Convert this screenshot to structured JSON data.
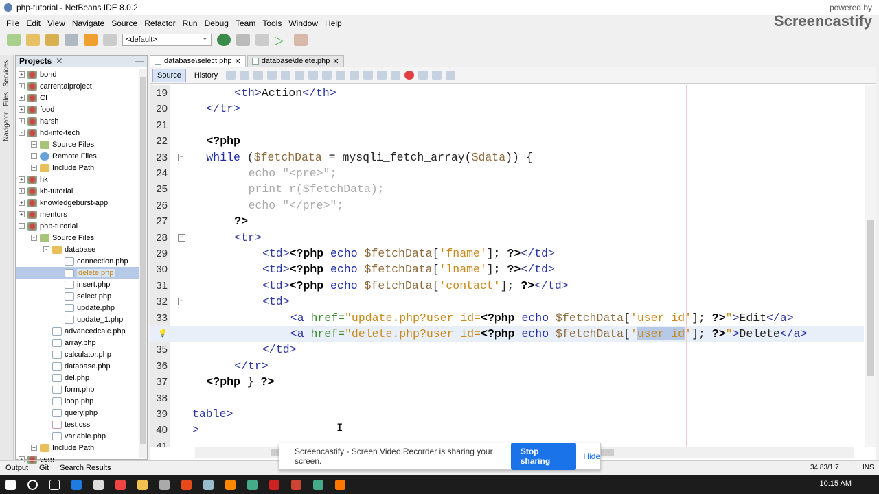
{
  "window": {
    "title": "php-tutorial - NetBeans IDE 8.0.2"
  },
  "menu": [
    "File",
    "Edit",
    "View",
    "Navigate",
    "Source",
    "Refactor",
    "Run",
    "Debug",
    "Team",
    "Tools",
    "Window",
    "Help"
  ],
  "toolbar": {
    "config": "<default>"
  },
  "side_tabs": [
    "Services",
    "Files",
    "Navigator"
  ],
  "projects": {
    "title": "Projects",
    "tree": [
      {
        "label": "bond",
        "d": 0,
        "t": "project",
        "e": "+"
      },
      {
        "label": "carrentalproject",
        "d": 0,
        "t": "project",
        "e": "+"
      },
      {
        "label": "CI",
        "d": 0,
        "t": "project",
        "e": "+"
      },
      {
        "label": "food",
        "d": 0,
        "t": "project",
        "e": "+"
      },
      {
        "label": "harsh",
        "d": 0,
        "t": "project",
        "e": "+"
      },
      {
        "label": "hd-info-tech",
        "d": 0,
        "t": "project",
        "e": "-"
      },
      {
        "label": "Source Files",
        "d": 1,
        "t": "srcfolder",
        "e": "+"
      },
      {
        "label": "Remote Files",
        "d": 1,
        "t": "remote",
        "e": "+"
      },
      {
        "label": "Include Path",
        "d": 1,
        "t": "folder",
        "e": "+"
      },
      {
        "label": "hk",
        "d": 0,
        "t": "project",
        "e": "+"
      },
      {
        "label": "kb-tutorial",
        "d": 0,
        "t": "project",
        "e": "+"
      },
      {
        "label": "knowledgeburst-app",
        "d": 0,
        "t": "project",
        "e": "+"
      },
      {
        "label": "mentors",
        "d": 0,
        "t": "project",
        "e": "+"
      },
      {
        "label": "php-tutorial",
        "d": 0,
        "t": "project",
        "e": "-"
      },
      {
        "label": "Source Files",
        "d": 1,
        "t": "srcfolder",
        "e": "-"
      },
      {
        "label": "database",
        "d": 2,
        "t": "folder",
        "e": "-"
      },
      {
        "label": "connection.php",
        "d": 3,
        "t": "file"
      },
      {
        "label": "delete.php",
        "d": 3,
        "t": "file",
        "sel": true
      },
      {
        "label": "insert.php",
        "d": 3,
        "t": "file"
      },
      {
        "label": "select.php",
        "d": 3,
        "t": "file"
      },
      {
        "label": "update.php",
        "d": 3,
        "t": "file"
      },
      {
        "label": "update_1.php",
        "d": 3,
        "t": "file"
      },
      {
        "label": "advancedcalc.php",
        "d": 2,
        "t": "file"
      },
      {
        "label": "array.php",
        "d": 2,
        "t": "file"
      },
      {
        "label": "calculator.php",
        "d": 2,
        "t": "file"
      },
      {
        "label": "database.php",
        "d": 2,
        "t": "file"
      },
      {
        "label": "del.php",
        "d": 2,
        "t": "file"
      },
      {
        "label": "form.php",
        "d": 2,
        "t": "file"
      },
      {
        "label": "loop.php",
        "d": 2,
        "t": "file"
      },
      {
        "label": "query.php",
        "d": 2,
        "t": "file"
      },
      {
        "label": "test.css",
        "d": 2,
        "t": "css"
      },
      {
        "label": "variable.php",
        "d": 2,
        "t": "file"
      },
      {
        "label": "Include Path",
        "d": 1,
        "t": "folder",
        "e": "+"
      },
      {
        "label": "vem",
        "d": 0,
        "t": "project",
        "e": "+"
      }
    ]
  },
  "editor": {
    "tabs": [
      {
        "label": "database\\select.php",
        "active": true
      },
      {
        "label": "database\\delete.php",
        "active": false
      }
    ],
    "modes": [
      "Source",
      "History"
    ],
    "lines": [
      {
        "n": "19",
        "i": 6,
        "tok": [
          [
            "tag",
            "<th>"
          ],
          [
            "pl",
            "Action"
          ],
          [
            "tag",
            "</th>"
          ]
        ]
      },
      {
        "n": "20",
        "i": 2,
        "tok": [
          [
            "tag",
            "</tr>"
          ]
        ]
      },
      {
        "n": "21",
        "i": 0,
        "tok": []
      },
      {
        "n": "22",
        "i": 2,
        "tok": [
          [
            "kw",
            "<?php"
          ]
        ]
      },
      {
        "n": "23",
        "i": 2,
        "f": "-",
        "tok": [
          [
            "echo",
            "while "
          ],
          [
            "pl",
            "("
          ],
          [
            "var",
            "$fetchData"
          ],
          [
            "pl",
            " = mysqli_fetch_array("
          ],
          [
            "var",
            "$data"
          ],
          [
            "pl",
            ")) {"
          ]
        ]
      },
      {
        "n": "24",
        "i": 8,
        "tok": [
          [
            "cm",
            "echo \"<pre>\";"
          ]
        ]
      },
      {
        "n": "25",
        "i": 8,
        "tok": [
          [
            "cm",
            "print_r($fetchData);"
          ]
        ]
      },
      {
        "n": "26",
        "i": 8,
        "tok": [
          [
            "cm",
            "echo \"</pre>\";"
          ]
        ]
      },
      {
        "n": "27",
        "i": 6,
        "tok": [
          [
            "kw",
            "?>"
          ]
        ]
      },
      {
        "n": "28",
        "i": 6,
        "f": "-",
        "tok": [
          [
            "tag",
            "<tr>"
          ]
        ]
      },
      {
        "n": "29",
        "i": 10,
        "tok": [
          [
            "tag",
            "<td>"
          ],
          [
            "kw",
            "<?php"
          ],
          [
            "echo",
            " echo "
          ],
          [
            "var",
            "$fetchData"
          ],
          [
            "pl",
            "["
          ],
          [
            "str",
            "'fname'"
          ],
          [
            "pl",
            "]; "
          ],
          [
            "kw",
            "?>"
          ],
          [
            "tag",
            "</td>"
          ]
        ]
      },
      {
        "n": "30",
        "i": 10,
        "tok": [
          [
            "tag",
            "<td>"
          ],
          [
            "kw",
            "<?php"
          ],
          [
            "echo",
            " echo "
          ],
          [
            "var",
            "$fetchData"
          ],
          [
            "pl",
            "["
          ],
          [
            "str",
            "'lname'"
          ],
          [
            "pl",
            "]; "
          ],
          [
            "kw",
            "?>"
          ],
          [
            "tag",
            "</td>"
          ]
        ]
      },
      {
        "n": "31",
        "i": 10,
        "tok": [
          [
            "tag",
            "<td>"
          ],
          [
            "kw",
            "<?php"
          ],
          [
            "echo",
            " echo "
          ],
          [
            "var",
            "$fetchData"
          ],
          [
            "pl",
            "["
          ],
          [
            "str",
            "'contact'"
          ],
          [
            "pl",
            "]; "
          ],
          [
            "kw",
            "?>"
          ],
          [
            "tag",
            "</td>"
          ]
        ]
      },
      {
        "n": "32",
        "i": 10,
        "f": "-",
        "tok": [
          [
            "tag",
            "<td>"
          ]
        ]
      },
      {
        "n": "33",
        "i": 14,
        "tok": [
          [
            "tag",
            "<a "
          ],
          [
            "attr",
            "href="
          ],
          [
            "str",
            "\"update.php?user_id="
          ],
          [
            "kw",
            "<?php"
          ],
          [
            "echo",
            " echo "
          ],
          [
            "var",
            "$fetchData"
          ],
          [
            "pl",
            "["
          ],
          [
            "str",
            "'user_id'"
          ],
          [
            "pl",
            "]; "
          ],
          [
            "kw",
            "?>"
          ],
          [
            "str",
            "\""
          ],
          [
            "tag",
            ">"
          ],
          [
            "pl",
            "Edit"
          ],
          [
            "tag",
            "</a>"
          ]
        ]
      },
      {
        "n": "34",
        "i": 14,
        "hl": true,
        "bulb": true,
        "tok": [
          [
            "tag",
            "<a "
          ],
          [
            "attr",
            "href="
          ],
          [
            "str",
            "\"delete.php?user_id="
          ],
          [
            "kw",
            "<?php"
          ],
          [
            "echo",
            " echo "
          ],
          [
            "var",
            "$fetchData"
          ],
          [
            "pl",
            "["
          ],
          [
            "str",
            "'"
          ],
          [
            "sel",
            "user_id"
          ],
          [
            "str",
            "'"
          ],
          [
            "pl",
            "]; "
          ],
          [
            "kw",
            "?>"
          ],
          [
            "str",
            "\""
          ],
          [
            "tag",
            ">"
          ],
          [
            "pl",
            "Delete"
          ],
          [
            "tag",
            "</a>"
          ]
        ]
      },
      {
        "n": "35",
        "i": 10,
        "tok": [
          [
            "tag",
            "</td>"
          ]
        ]
      },
      {
        "n": "36",
        "i": 6,
        "tok": [
          [
            "tag",
            "</tr>"
          ]
        ]
      },
      {
        "n": "37",
        "i": 2,
        "tok": [
          [
            "kw",
            "<?php"
          ],
          [
            "pl",
            " } "
          ],
          [
            "kw",
            "?>"
          ]
        ]
      },
      {
        "n": "38",
        "i": 0,
        "tok": []
      },
      {
        "n": "39",
        "i": 0,
        "tok": [
          [
            "tag",
            "table>"
          ]
        ]
      },
      {
        "n": "40",
        "i": 0,
        "tok": [
          [
            "tag",
            ">"
          ]
        ]
      },
      {
        "n": "41",
        "i": 0,
        "tok": []
      }
    ]
  },
  "statusbar": {
    "items": [
      "Output",
      "Git",
      "Search Results"
    ],
    "position": "34:83/1:7",
    "mode": "INS"
  },
  "taskbar": {
    "clock": "10:15 AM"
  },
  "notification": {
    "text": "Screencastify - Screen Video Recorder is sharing your screen.",
    "stop": "Stop sharing",
    "hide": "Hide"
  },
  "watermark": {
    "powered": "powered by",
    "brand": "Screencastify"
  }
}
